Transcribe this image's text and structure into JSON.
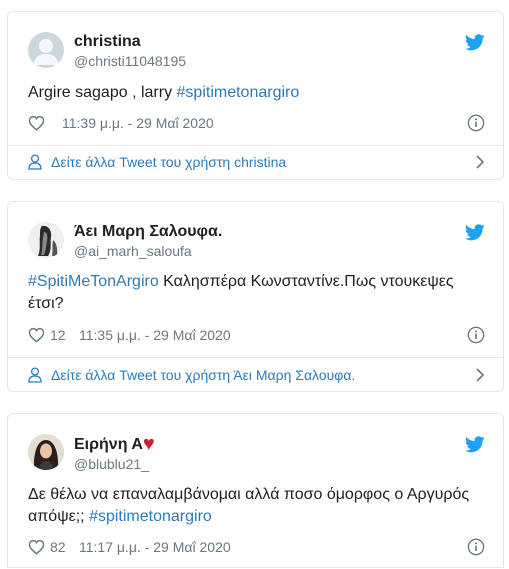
{
  "colors": {
    "link": "#2b7bb9",
    "muted": "#697882",
    "border": "#e1e8ed",
    "twitter_blue": "#1da1f2",
    "heart_red": "#cc1f36"
  },
  "tweets": [
    {
      "display_name": "christina",
      "handle": "@christi11048195",
      "text_plain": "Argire sagapo , larry ",
      "hashtag": "#spitimetonargiro",
      "likes": "",
      "timestamp": "11:39 μ.μ. - 29 Μαΐ 2020",
      "more_label": "Δείτε άλλα Tweet του χρήστη christina",
      "avatar_icon": "default-profile-egg-icon"
    },
    {
      "display_name": "Άει Μαρη Σαλουφα.",
      "handle": "@ai_marh_saloufa",
      "hashtag": "#SpitiMeTonArgiro",
      "text_plain": " Καλησπέρα Κωνσταντίνε.Πως ντουκεψες έτσι?",
      "likes": "12",
      "timestamp": "11:35 μ.μ. - 29 Μαΐ 2020",
      "more_label": "Δείτε άλλα Tweet του χρήστη Άει Μαρη Σαλουφα.",
      "avatar_icon": "profile-photo"
    },
    {
      "display_name": "Ειρήνη Α",
      "name_emoji": "♥",
      "handle": "@blublu21_",
      "text_plain": "Δε θέλω να επαναλαμβάνομαι αλλά ποσο όμορφος ο Αργυρός απόψε;; ",
      "hashtag": "#spitimetonargiro",
      "likes": "82",
      "timestamp": "11:17 μ.μ. - 29 Μαΐ 2020",
      "avatar_icon": "profile-photo"
    }
  ]
}
